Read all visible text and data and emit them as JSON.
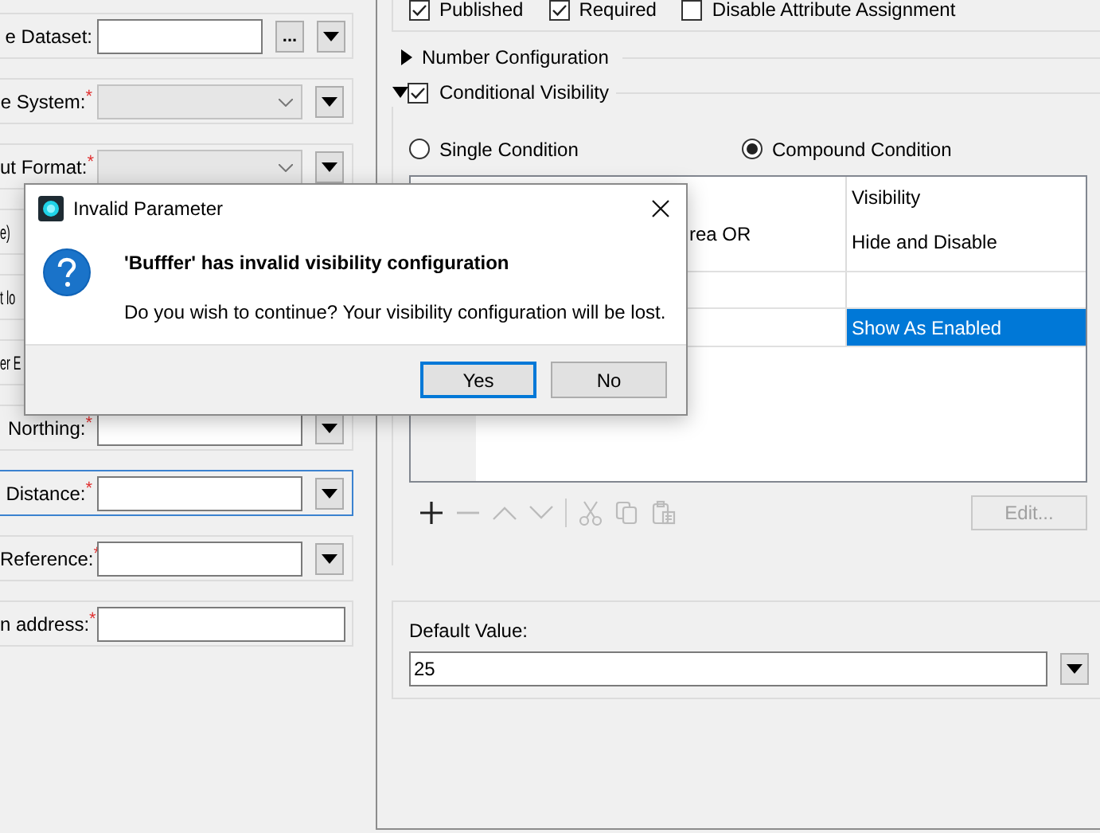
{
  "form_rows": [
    {
      "kind": "browse",
      "label": "e Dataset:",
      "focused": false,
      "browse_label": "..."
    },
    {
      "kind": "combo",
      "label": "e System:",
      "required_mark": "*",
      "focused": false
    },
    {
      "kind": "combo",
      "label": "ut Format:",
      "required_mark": "*",
      "focused": false
    },
    {
      "kind": "covered",
      "label": "e)",
      "focused": false
    },
    {
      "kind": "covered",
      "label": "t lo",
      "focused": false
    },
    {
      "kind": "covered",
      "label": "er E",
      "focused": false
    },
    {
      "kind": "text",
      "label": "Northing:",
      "required_mark": "*",
      "focused": false
    },
    {
      "kind": "text",
      "label": "Distance:",
      "required_mark": "*",
      "focused": true
    },
    {
      "kind": "text",
      "label": "Reference:",
      "required_mark": "*",
      "focused": false
    },
    {
      "kind": "plain",
      "label": "n address:",
      "required_mark": "*",
      "focused": false
    }
  ],
  "options": [
    {
      "label": "Published",
      "checked": true
    },
    {
      "label": "Required",
      "checked": true
    },
    {
      "label": "Disable Attribute Assignment",
      "checked": false
    }
  ],
  "number_configuration": {
    "label": "Number Configuration",
    "expanded": false
  },
  "conditional_visibility": {
    "label": "Conditional Visibility",
    "expanded": true,
    "checked": true
  },
  "condition_types": [
    {
      "label": "Single Condition",
      "selected": false
    },
    {
      "label": "Compound Condition",
      "selected": true
    }
  ],
  "conditions_table": {
    "visibility_header": "Visibility",
    "rows": [
      {
        "condition": "rea OR",
        "visibility": "Hide and Disable",
        "selected": false
      },
      {
        "selected": false
      },
      {
        "visibility": "Show As Enabled",
        "selected": true
      }
    ]
  },
  "edit_button": {
    "label": "Edit...",
    "disabled": true
  },
  "default_value": {
    "label": "Default Value:",
    "value": "25"
  },
  "dialog": {
    "title": "Invalid Parameter",
    "heading": "'Bufffer' has invalid visibility configuration",
    "message": "Do you wish to continue? Your visibility configuration will be lost.",
    "buttons": [
      {
        "label": "Yes",
        "focused": true
      },
      {
        "label": "No",
        "focused": false
      }
    ]
  }
}
